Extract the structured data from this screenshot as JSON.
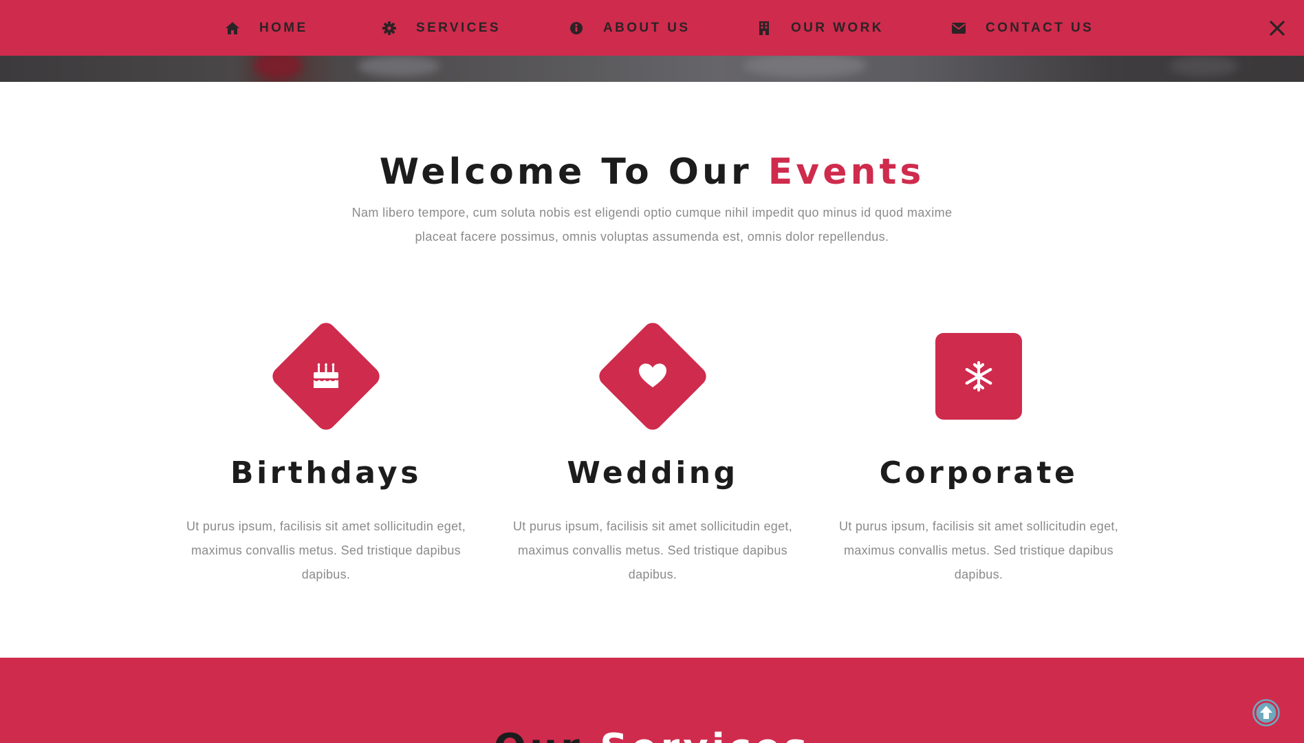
{
  "nav": {
    "items": [
      {
        "label": "HOME",
        "icon": "home-icon"
      },
      {
        "label": "SERVICES",
        "icon": "gear-icon"
      },
      {
        "label": "ABOUT US",
        "icon": "info-icon"
      },
      {
        "label": "OUR WORK",
        "icon": "building-icon"
      },
      {
        "label": "CONTACT US",
        "icon": "envelope-icon"
      }
    ],
    "close_icon": "close-icon"
  },
  "welcome": {
    "title_main": "Welcome To Our",
    "title_accent": "Events",
    "intro": "Nam libero tempore, cum soluta nobis est eligendi optio cumque nihil impedit quo minus id quod maxime placeat facere possimus, omnis voluptas assumenda est, omnis dolor repellendus."
  },
  "events": [
    {
      "title": "Birthdays",
      "icon": "birthday-cake-icon",
      "description": "Ut purus ipsum, facilisis sit amet sollicitudin eget, maximus convallis metus. Sed tristique dapibus dapibus."
    },
    {
      "title": "Wedding",
      "icon": "heart-icon",
      "description": "Ut purus ipsum, facilisis sit amet sollicitudin eget, maximus convallis metus. Sed tristique dapibus dapibus."
    },
    {
      "title": "Corporate",
      "icon": "snowflake-icon",
      "description": "Ut purus ipsum, facilisis sit amet sollicitudin eget, maximus convallis metus. Sed tristique dapibus dapibus."
    }
  ],
  "services": {
    "title_main": "Our",
    "title_accent": "Services"
  },
  "scroll_top_icon": "arrow-up-circle-icon",
  "colors": {
    "accent": "#cf2b4d",
    "heading": "#1c1c1c",
    "body_text": "#8a8a8a",
    "nav_text": "#2b2325"
  }
}
